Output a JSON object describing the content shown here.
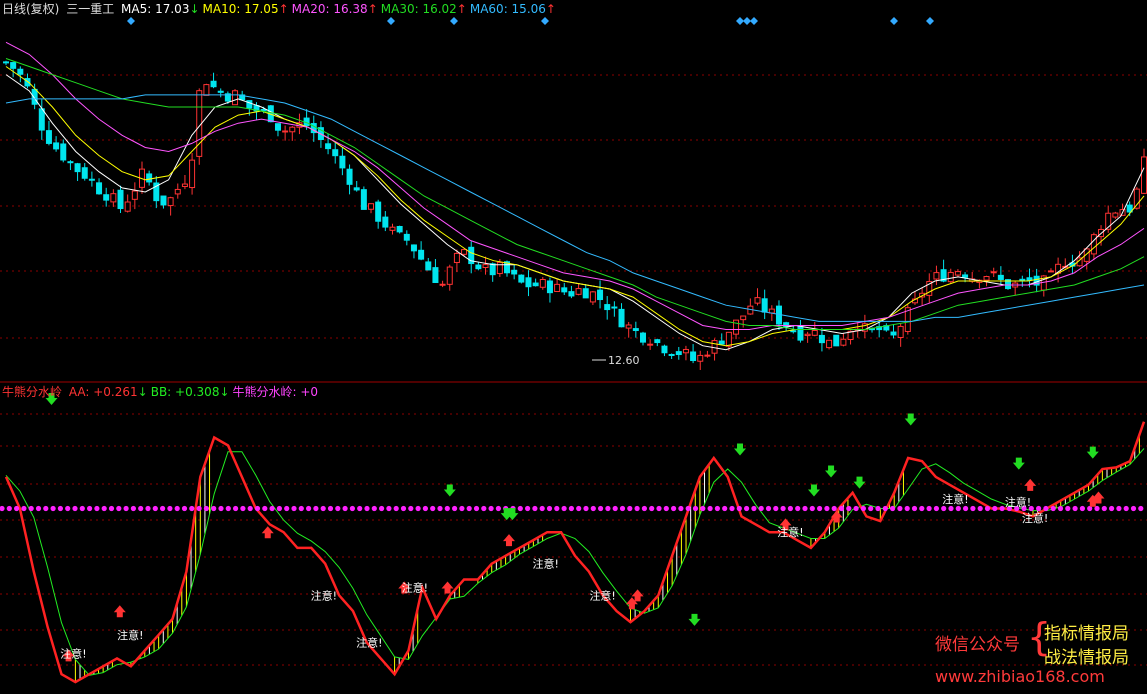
{
  "main_header": {
    "period": "日线(复权)",
    "stock": "三一重工",
    "ma": [
      {
        "label": "MA5: 17.03",
        "arrow": "↓",
        "color": "#ffffff"
      },
      {
        "label": "MA10: 17.05",
        "arrow": "↑",
        "color": "#ffff00"
      },
      {
        "label": "MA20: 16.38",
        "arrow": "↑",
        "color": "#ff55ff"
      },
      {
        "label": "MA30: 16.02",
        "arrow": "↑",
        "color": "#22dd22"
      },
      {
        "label": "MA60: 15.06",
        "arrow": "↑",
        "color": "#33bbff"
      }
    ]
  },
  "sub_header": {
    "name": "牛熊分水岭",
    "items": [
      {
        "label": "AA: +0.261",
        "arrow": "↓",
        "color": "#ff3333"
      },
      {
        "label": "BB: +0.308",
        "arrow": "↓",
        "color": "#22ee22"
      },
      {
        "label": "牛熊分水岭: +0",
        "arrow": "",
        "color": "#ff44ff"
      }
    ]
  },
  "low_marker": "12.60",
  "note_label": "注意!",
  "watermark": {
    "left": "微信公众号",
    "brace": "{",
    "line1": "指标情报局",
    "line2": "战法情报局",
    "url": "www.zhibiao168.com"
  },
  "colors": {
    "up": "#ff3333",
    "down": "#00e5ee",
    "grid": "#8b0000",
    "divider": "#a00000",
    "zero_line": "#ff22ff",
    "signal_down": "#22dd22",
    "signal_up": "#ff3333"
  },
  "chart_data": {
    "type": "candlestick+indicator",
    "price_axis": {
      "min": 11.8,
      "max": 20.6
    },
    "price_curve": [
      19.5,
      19.3,
      18.8,
      18.0,
      17.5,
      17.2,
      16.9,
      16.7,
      16.4,
      16.2,
      15.9,
      16.3,
      16.8,
      16.2,
      16.0,
      16.4,
      16.8,
      19.2,
      18.9,
      18.7,
      18.7,
      18.4,
      18.3,
      18.2,
      17.8,
      17.9,
      18.0,
      17.7,
      17.4,
      17.0,
      16.6,
      16.0,
      15.8,
      15.5,
      15.2,
      15.1,
      14.7,
      14.3,
      14.0,
      14.6,
      14.8,
      14.5,
      14.3,
      14.4,
      14.2,
      14.0,
      14.0,
      14.0,
      13.9,
      13.8,
      13.9,
      13.8,
      13.6,
      13.3,
      13.0,
      12.8,
      12.7,
      12.5,
      12.4,
      12.3,
      12.1,
      12.4,
      12.6,
      12.9,
      13.2,
      13.6,
      13.4,
      13.2,
      13.0,
      12.8,
      12.9,
      12.7,
      12.5,
      12.8,
      13.1,
      12.8,
      12.9,
      12.6,
      13.1,
      13.5,
      14.0,
      14.2,
      14.3,
      14.4,
      14.2,
      14.3,
      14.2,
      14.0,
      14.0,
      14.1,
      14.0,
      14.2,
      14.6,
      14.6,
      14.8,
      15.4,
      15.8,
      15.9,
      15.9,
      17.0
    ],
    "ma_series": [
      {
        "name": "MA5",
        "values": [
          19.2,
          18.8,
          18.0,
          17.3,
          16.8,
          16.4,
          16.3,
          16.6,
          17.7,
          18.4,
          18.6,
          18.4,
          18.1,
          17.9,
          17.6,
          17.2,
          16.6,
          16.0,
          15.5,
          15.0,
          14.6,
          14.5,
          14.5,
          14.3,
          14.1,
          14.0,
          13.9,
          13.6,
          13.2,
          12.8,
          12.5,
          12.4,
          12.6,
          12.9,
          13.0,
          12.9,
          12.8,
          12.9,
          13.2,
          13.8,
          14.1,
          14.2,
          14.1,
          14.0,
          14.0,
          14.2,
          14.6,
          15.2,
          15.7,
          16.9
        ]
      },
      {
        "name": "MA10",
        "values": [
          19.4,
          19.0,
          18.4,
          17.7,
          17.2,
          16.8,
          16.6,
          16.7,
          17.3,
          17.9,
          18.2,
          18.3,
          18.1,
          17.9,
          17.6,
          17.2,
          16.7,
          16.1,
          15.6,
          15.2,
          14.8,
          14.6,
          14.5,
          14.3,
          14.1,
          14.0,
          13.9,
          13.7,
          13.3,
          12.9,
          12.6,
          12.5,
          12.6,
          12.8,
          12.9,
          12.9,
          12.9,
          13.0,
          13.2,
          13.6,
          13.9,
          14.1,
          14.1,
          14.1,
          14.1,
          14.2,
          14.5,
          15.0,
          15.5,
          16.2
        ]
      },
      {
        "name": "MA20",
        "values": [
          20.0,
          19.7,
          19.2,
          18.6,
          18.1,
          17.7,
          17.4,
          17.3,
          17.5,
          17.8,
          18.0,
          18.1,
          18.0,
          17.9,
          17.6,
          17.3,
          16.9,
          16.4,
          15.9,
          15.5,
          15.1,
          14.9,
          14.7,
          14.5,
          14.3,
          14.2,
          14.1,
          13.9,
          13.6,
          13.3,
          13.0,
          12.9,
          12.9,
          13.0,
          13.0,
          13.0,
          13.0,
          13.1,
          13.2,
          13.4,
          13.6,
          13.8,
          13.9,
          14.0,
          14.0,
          14.1,
          14.3,
          14.7,
          15.0,
          15.4
        ]
      },
      {
        "name": "MA30",
        "values": [
          19.6,
          19.4,
          19.2,
          19.0,
          18.8,
          18.6,
          18.5,
          18.4,
          18.4,
          18.4,
          18.4,
          18.3,
          18.2,
          18.0,
          17.7,
          17.4,
          17.0,
          16.6,
          16.2,
          15.9,
          15.6,
          15.3,
          15.0,
          14.8,
          14.6,
          14.4,
          14.2,
          14.0,
          13.7,
          13.5,
          13.3,
          13.1,
          13.0,
          13.0,
          12.9,
          12.9,
          12.9,
          12.9,
          13.0,
          13.1,
          13.3,
          13.5,
          13.6,
          13.7,
          13.8,
          13.9,
          14.0,
          14.2,
          14.4,
          14.7
        ]
      },
      {
        "name": "MA60",
        "values": [
          18.5,
          18.6,
          18.6,
          18.6,
          18.6,
          18.6,
          18.7,
          18.7,
          18.7,
          18.7,
          18.7,
          18.6,
          18.5,
          18.3,
          18.1,
          17.8,
          17.5,
          17.2,
          16.9,
          16.6,
          16.3,
          16.0,
          15.7,
          15.4,
          15.1,
          14.8,
          14.6,
          14.3,
          14.1,
          13.9,
          13.7,
          13.5,
          13.4,
          13.3,
          13.2,
          13.1,
          13.1,
          13.1,
          13.1,
          13.1,
          13.2,
          13.2,
          13.3,
          13.4,
          13.5,
          13.6,
          13.7,
          13.8,
          13.9,
          14.0
        ]
      }
    ],
    "indicator_axis": {
      "min": -1.15,
      "max": 0.7
    },
    "indicator": {
      "AA": [
        0.2,
        0.0,
        -0.4,
        -0.75,
        -1.05,
        -1.1,
        -1.05,
        -1.0,
        -0.95,
        -1.0,
        -0.9,
        -0.8,
        -0.7,
        -0.4,
        0.2,
        0.45,
        0.4,
        0.2,
        0.0,
        -0.1,
        -0.15,
        -0.25,
        -0.25,
        -0.35,
        -0.55,
        -0.65,
        -0.85,
        -0.95,
        -1.05,
        -0.9,
        -0.5,
        -0.7,
        -0.55,
        -0.45,
        -0.45,
        -0.35,
        -0.3,
        -0.25,
        -0.2,
        -0.15,
        -0.15,
        -0.3,
        -0.4,
        -0.55,
        -0.65,
        -0.72,
        -0.65,
        -0.55,
        -0.3,
        -0.05,
        0.2,
        0.32,
        0.2,
        -0.05,
        -0.1,
        -0.15,
        -0.15,
        -0.2,
        -0.25,
        -0.15,
        0.0,
        0.1,
        -0.05,
        -0.08,
        0.1,
        0.32,
        0.3,
        0.2,
        0.15,
        0.1,
        0.05,
        0.0,
        0.0,
        -0.02,
        -0.05,
        0.0,
        0.05,
        0.1,
        0.15,
        0.25,
        0.26,
        0.3,
        0.55
      ]
    },
    "zero_line": 0,
    "signals_down": [
      [
        0.4,
        0.58
      ],
      [
        3.9,
        0.0
      ],
      [
        -0.95,
        -1.08
      ],
      [
        -0.95,
        -0.55
      ],
      [
        4.4,
        -0.15
      ],
      [
        4.45,
        -0.15
      ],
      [
        6.05,
        -0.82
      ],
      [
        6.45,
        0.26
      ],
      [
        7.1,
        0.0
      ],
      [
        7.95,
        0.45
      ],
      [
        7.5,
        0.05
      ],
      [
        7.25,
        0.12
      ],
      [
        9.55,
        0.24
      ],
      [
        8.9,
        0.17
      ]
    ],
    "signals_up": [
      [
        0.55,
        -0.88
      ],
      [
        1.0,
        -0.6
      ],
      [
        2.3,
        -0.1
      ],
      [
        3.5,
        -0.45
      ],
      [
        3.88,
        -0.45
      ],
      [
        4.42,
        -0.15
      ],
      [
        5.5,
        -0.55
      ],
      [
        5.55,
        -0.5
      ],
      [
        6.85,
        -0.05
      ],
      [
        7.3,
        0.0
      ],
      [
        9.0,
        0.2
      ],
      [
        9.55,
        0.1
      ],
      [
        9.6,
        0.12
      ]
    ],
    "notes": [
      [
        0.6,
        -0.92
      ],
      [
        1.1,
        -0.8
      ],
      [
        2.8,
        -0.55
      ],
      [
        3.2,
        -0.85
      ],
      [
        3.6,
        -0.5
      ],
      [
        4.75,
        -0.35
      ],
      [
        5.25,
        -0.55
      ],
      [
        6.9,
        -0.15
      ],
      [
        8.35,
        0.06
      ],
      [
        8.9,
        0.04
      ],
      [
        9.05,
        -0.06
      ]
    ]
  }
}
